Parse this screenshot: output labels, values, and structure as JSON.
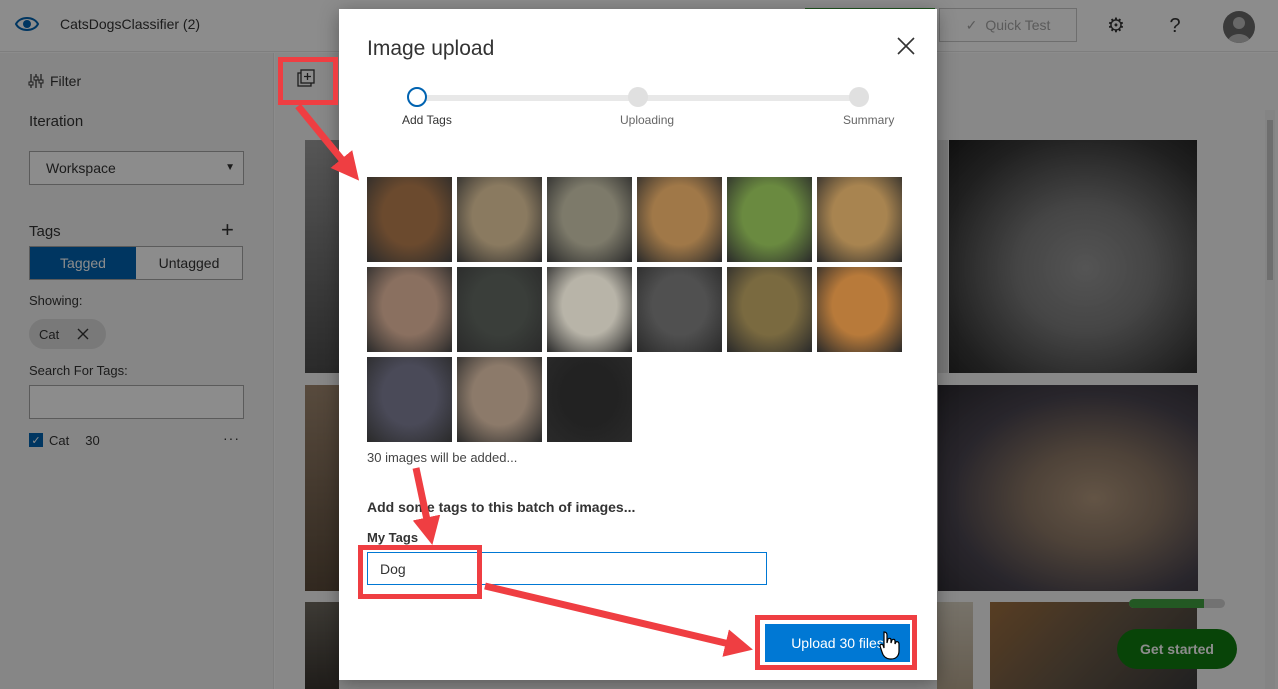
{
  "app": {
    "title": "CatsDogsClassifier (2)",
    "quick_test_label": "Quick Test"
  },
  "sidebar": {
    "filter_label": "Filter",
    "iteration_label": "Iteration",
    "iteration_value": "Workspace",
    "tags_label": "Tags",
    "toggle": {
      "tagged": "Tagged",
      "untagged": "Untagged"
    },
    "showing_label": "Showing:",
    "showing_chip": "Cat",
    "search_label": "Search For Tags:",
    "search_value": "",
    "tag_list": [
      {
        "name": "Cat",
        "count": "30",
        "checked": true
      }
    ]
  },
  "main": {
    "get_started_label": "Get started",
    "training_progress": 0.78
  },
  "dialog": {
    "title": "Image upload",
    "steps": [
      {
        "label": "Add Tags",
        "active": true
      },
      {
        "label": "Uploading",
        "active": false
      },
      {
        "label": "Summary",
        "active": false
      }
    ],
    "added_text": "30 images will be added...",
    "batch_text": "Add some tags to this batch of images...",
    "my_tags_label": "My Tags",
    "tag_value": "Dog",
    "upload_button": "Upload 30 files",
    "thumbnails": [
      {
        "color": "#6b4a2e"
      },
      {
        "color": "#8a7a60"
      },
      {
        "color": "#7d7a6a"
      },
      {
        "color": "#a07848"
      },
      {
        "color": "#6a8a40"
      },
      {
        "color": "#a88450"
      },
      {
        "color": "#8a7060"
      },
      {
        "color": "#3a3e3a"
      },
      {
        "color": "#b8b4a8"
      },
      {
        "color": "#505050"
      },
      {
        "color": "#7a6a40"
      },
      {
        "color": "#b87a3a"
      },
      {
        "color": "#4a4a58"
      },
      {
        "color": "#8c7a6a"
      },
      {
        "color": "#222222"
      }
    ]
  },
  "colors": {
    "accent": "#0078d4",
    "tagged_active": "#0063b1",
    "callout": "#ef3e42",
    "get_started": "#107c10"
  },
  "icons": {
    "app": "eye-icon",
    "settings": "gear-icon",
    "help": "question-icon",
    "close": "close-icon",
    "add_images": "add-images-icon",
    "filter": "filter-icon",
    "add_tag": "plus-icon",
    "remove_chip": "close-icon",
    "more": "ellipsis-icon",
    "check": "check-icon",
    "cursor": "hand-cursor-icon"
  }
}
